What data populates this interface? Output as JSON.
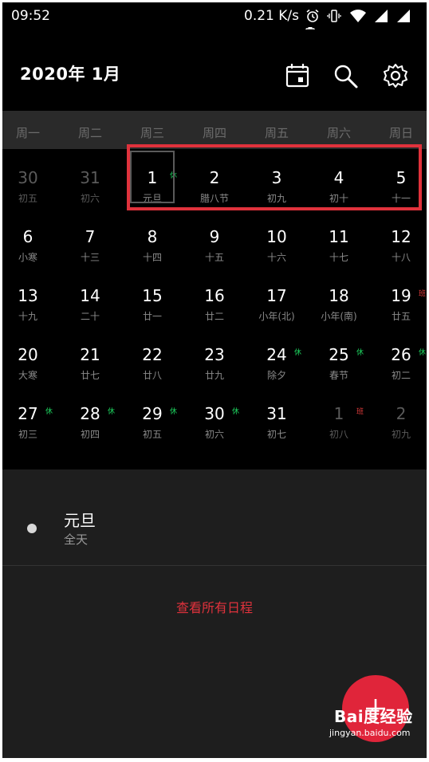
{
  "status_bar": {
    "time": "09:52",
    "speed": "0.21 K/s",
    "icons": [
      "alarm-icon",
      "vibrate-icon",
      "wifi-icon",
      "signal-icon",
      "signal-icon",
      "battery-icon"
    ]
  },
  "header": {
    "title": "2020年  1月",
    "icons": [
      "calendar-today-icon",
      "search-icon",
      "gear-icon"
    ]
  },
  "weekdays": [
    "周一",
    "周二",
    "周三",
    "周四",
    "周五",
    "周六",
    "周日"
  ],
  "calendar": {
    "weeks": [
      [
        {
          "day": "30",
          "lunar": "初五",
          "dim": true
        },
        {
          "day": "31",
          "lunar": "初六",
          "dim": true
        },
        {
          "day": "1",
          "lunar": "元旦",
          "badge": "休",
          "today": true
        },
        {
          "day": "2",
          "lunar": "腊八节"
        },
        {
          "day": "3",
          "lunar": "初九"
        },
        {
          "day": "4",
          "lunar": "初十"
        },
        {
          "day": "5",
          "lunar": "十一"
        }
      ],
      [
        {
          "day": "6",
          "lunar": "小寒"
        },
        {
          "day": "7",
          "lunar": "十三"
        },
        {
          "day": "8",
          "lunar": "十四"
        },
        {
          "day": "9",
          "lunar": "十五"
        },
        {
          "day": "10",
          "lunar": "十六"
        },
        {
          "day": "11",
          "lunar": "十七"
        },
        {
          "day": "12",
          "lunar": "十八"
        }
      ],
      [
        {
          "day": "13",
          "lunar": "十九"
        },
        {
          "day": "14",
          "lunar": "二十"
        },
        {
          "day": "15",
          "lunar": "廿一"
        },
        {
          "day": "16",
          "lunar": "廿二"
        },
        {
          "day": "17",
          "lunar": "小年(北)"
        },
        {
          "day": "18",
          "lunar": "小年(南)"
        },
        {
          "day": "19",
          "lunar": "廿五",
          "badge": "班",
          "badge_type": "work"
        }
      ],
      [
        {
          "day": "20",
          "lunar": "大寒"
        },
        {
          "day": "21",
          "lunar": "廿七"
        },
        {
          "day": "22",
          "lunar": "廿八"
        },
        {
          "day": "23",
          "lunar": "廿九"
        },
        {
          "day": "24",
          "lunar": "除夕",
          "badge": "休"
        },
        {
          "day": "25",
          "lunar": "春节",
          "badge": "休"
        },
        {
          "day": "26",
          "lunar": "初二",
          "badge": "休"
        }
      ],
      [
        {
          "day": "27",
          "lunar": "初三",
          "badge": "休"
        },
        {
          "day": "28",
          "lunar": "初四",
          "badge": "休"
        },
        {
          "day": "29",
          "lunar": "初五",
          "badge": "休"
        },
        {
          "day": "30",
          "lunar": "初六",
          "badge": "休"
        },
        {
          "day": "31",
          "lunar": "初七"
        },
        {
          "day": "1",
          "lunar": "初八",
          "dim": true,
          "badge": "班",
          "badge_type": "work"
        },
        {
          "day": "2",
          "lunar": "初九",
          "dim": true
        }
      ]
    ]
  },
  "events": {
    "items": [
      {
        "title": "元旦",
        "time": "全天"
      }
    ],
    "view_all": "查看所有日程"
  },
  "watermark": {
    "logo": "Bai度经验",
    "url": "jingyan.baidu.com"
  },
  "colors": {
    "accent": "#e0253a",
    "holiday_badge": "#1ed760",
    "work_badge": "#e23c3c"
  }
}
